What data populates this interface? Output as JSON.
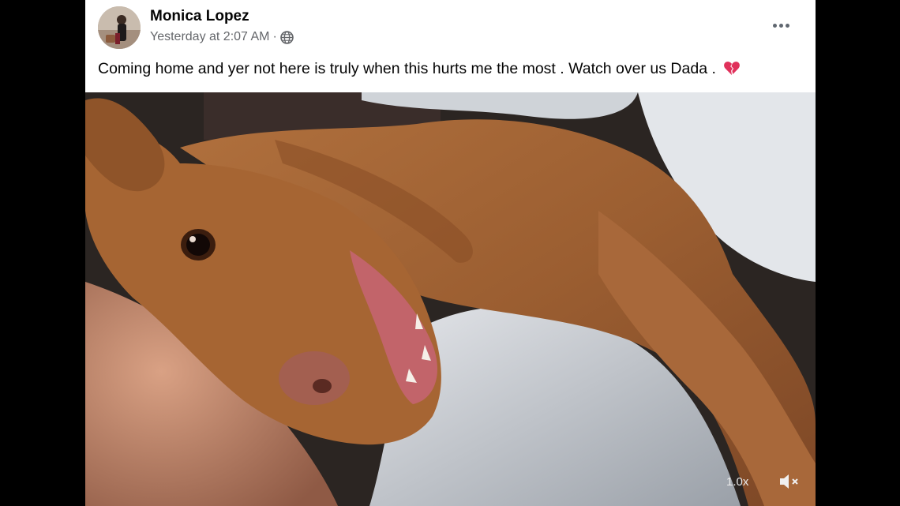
{
  "post": {
    "author": "Monica Lopez",
    "timestamp": "Yesterday at 2:07 AM",
    "meta_separator": " · ",
    "privacy_icon": "globe-icon",
    "more_icon": "more-options-icon",
    "caption": "Coming home and yer not here is truly when this hurts me the most . Watch over us Dada .",
    "caption_emoji": "broken-heart-icon"
  },
  "video": {
    "subject": "brown dog lying on bed",
    "playback_speed": "1.0x",
    "mute_icon": "muted-speaker-icon"
  },
  "colors": {
    "name_text": "#050505",
    "meta_text": "#65676b",
    "heart": "#e0315b",
    "background": "#000000"
  }
}
